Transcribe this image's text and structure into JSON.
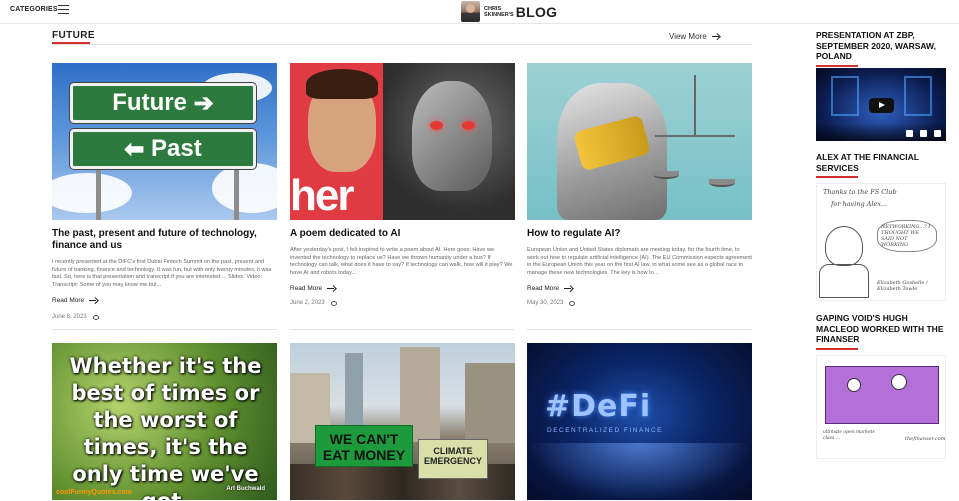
{
  "header": {
    "categories_label": "CATEGORIES",
    "logo_small_line1": "CHRIS",
    "logo_small_line2": "SKINNER'S",
    "logo_big": "BLOG"
  },
  "section": {
    "title": "FUTURE",
    "view_more": "View More"
  },
  "cards": [
    {
      "title": "The past, present and future of technology, finance and us",
      "excerpt": "I recently presented at the DIFC's first Dubai Fintech Summit on the past, present and future of banking, finance and technology. It was fun, but with only twenty minutes, it was fast. So, here is that presentation and transcript if you are interested ... Slides:  Video: Transcript: Some of you may know me but...",
      "read_more": "Read More",
      "date": "June 8, 2023",
      "image_text": {
        "future": "Future",
        "past": "Past"
      }
    },
    {
      "title": "A poem dedicated to AI",
      "excerpt": "After yesterday's post, I felt inspired to write a poem about AI. Here goes: Have we invented the technology to replace us? Have we thrown humanity under a bus? If technology can talk, what does it have to say? If technology can walk, how will it play? We have AI and robots today...",
      "read_more": "Read More",
      "date": "June 2, 2023",
      "image_text": {
        "her": "her"
      }
    },
    {
      "title": "How to regulate AI?",
      "excerpt": "European Union and United States diplomats are meeting today, for the fourth time, to work out how to regulate artificial intelligence (AI). The EU Commission expects agreement in the European Union this year on the first AI law, in what some see as a global race to manage these new technologies. The key is how to...",
      "read_more": "Read More",
      "date": "May 30, 2023"
    },
    {
      "image_text": {
        "quote": "Whether it's the best of times or the worst of times, it's the only time we've got.",
        "author": "Art Buchwald",
        "site": "coolFunnyQuotes.com"
      }
    },
    {
      "image_text": {
        "banner": "WE CAN'T EAT MONEY",
        "banner2": "CLIMATE EMERGENCY"
      }
    },
    {
      "image_text": {
        "defi": "#DeFi",
        "defi_sub": "DECENTRALIZED FINANCE"
      }
    }
  ],
  "sidebar": [
    {
      "title": "PRESENTATION AT ZBP, SEPTEMBER 2020, WARSAW, POLAND"
    },
    {
      "title": "ALEX AT THE FINANCIAL SERVICES",
      "sketch_line1": "Thanks to the FS Club",
      "sketch_line2": "for having Alex...",
      "sketch_bubble": "NETWORKING...? I THOUGHT WE SAID NOT WORKING",
      "sketch_sign": "Elizabeth Gosbelle / Elizabeth Towle"
    },
    {
      "title": "GAPING VOID'S HUGH MACLEOD WORKED WITH THE FINANSER",
      "sketch_caption": "ultimate open markets class ... ",
      "sketch_sign": "thefinanser.com"
    }
  ],
  "colors": {
    "accent": "#d32f2f",
    "sign_green": "#2d7a3e",
    "banner_green": "#1d9a3c"
  }
}
